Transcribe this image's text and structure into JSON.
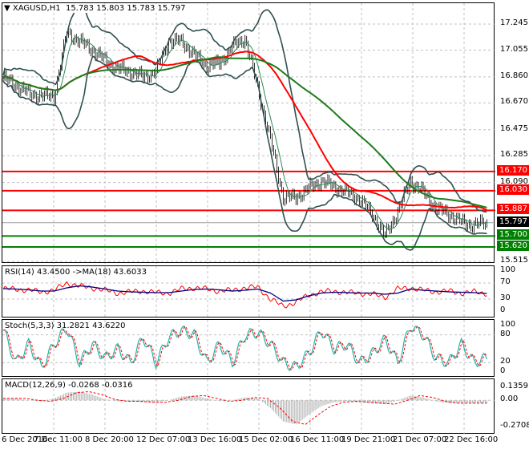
{
  "header": {
    "symbol": "XAGUSD,H1",
    "open": "15.783",
    "high": "15.803",
    "low": "15.783",
    "close": "15.797"
  },
  "indicators": {
    "rsi_label": "RSI(14) 43.4500  ->MA(18) 43.6033",
    "stoch_label": "Stoch(5,3,3) 31.2821 43.6220",
    "macd_label": "MACD(12,26,9) -0.0268 -0.0316"
  },
  "colors": {
    "red": "#ff0000",
    "green": "#008000",
    "ma_green": "#1e7a1e",
    "bands": "#2f4f4f",
    "current": "#000000",
    "rsi": "#ff0000",
    "rsi_ma": "#000080",
    "stoch_k": "#20b2aa",
    "stoch_d": "#ff0000",
    "hist": "#b0b0b0"
  },
  "chart_data": [
    {
      "type": "candlestick",
      "title": "XAGUSD,H1",
      "ylim": [
        15.515,
        17.245
      ],
      "yticks": [
        "17.245",
        "17.055",
        "16.860",
        "16.670",
        "16.475",
        "16.285",
        "16.090",
        "15.515"
      ],
      "xticks": [
        "6 Dec 2016",
        "7 Dec 11:00",
        "8 Dec 20:00",
        "12 Dec 07:00",
        "13 Dec 16:00",
        "15 Dec 02:00",
        "16 Dec 11:00",
        "19 Dec 21:00",
        "21 Dec 07:00",
        "22 Dec 16:00"
      ],
      "close_anchors_every_8_bars": [
        16.85,
        16.8,
        16.74,
        16.72,
        16.72,
        17.18,
        17.12,
        17.06,
        16.98,
        16.92,
        16.9,
        16.86,
        16.9,
        17.12,
        17.12,
        17.02,
        16.94,
        16.96,
        17.08,
        17.14,
        16.78,
        16.4,
        15.98,
        15.98,
        16.05,
        16.1,
        16.06,
        16.02,
        15.97,
        15.86,
        15.7,
        15.88,
        16.1,
        16.02,
        15.9,
        15.86,
        15.8,
        15.78,
        15.797
      ],
      "horizontal_levels": [
        {
          "value": "16.170",
          "color": "red"
        },
        {
          "value": "16.030",
          "color": "red"
        },
        {
          "value": "15.887",
          "color": "red"
        },
        {
          "value": "15.700",
          "color": "green"
        },
        {
          "value": "15.620",
          "color": "green"
        }
      ],
      "current_price": "15.797"
    },
    {
      "type": "line",
      "name": "RSI",
      "yticks": [
        "100",
        "70",
        "30",
        "0"
      ],
      "ylim": [
        0,
        100
      ],
      "rsi": [
        55,
        55,
        52,
        48,
        52,
        70,
        62,
        58,
        52,
        45,
        48,
        50,
        46,
        45,
        55,
        58,
        55,
        50,
        52,
        58,
        60,
        30,
        12,
        22,
        40,
        48,
        50,
        46,
        45,
        42,
        35,
        55,
        58,
        52,
        48,
        50,
        45,
        48,
        44
      ],
      "ma": [
        56,
        55,
        53,
        50,
        50,
        58,
        63,
        60,
        55,
        50,
        48,
        47,
        46,
        46,
        50,
        54,
        55,
        53,
        50,
        52,
        55,
        45,
        25,
        28,
        38,
        45,
        47,
        46,
        45,
        45,
        42,
        45,
        55,
        52,
        50,
        48,
        47,
        46,
        44
      ]
    },
    {
      "type": "line",
      "name": "Stochastic",
      "yticks": [
        "100",
        "80",
        "20",
        "0"
      ],
      "ylim": [
        0,
        100
      ],
      "k": [
        90,
        20,
        60,
        10,
        60,
        95,
        20,
        60,
        30,
        50,
        20,
        75,
        20,
        75,
        90,
        80,
        20,
        60,
        20,
        80,
        85,
        60,
        20,
        10,
        40,
        90,
        50,
        60,
        20,
        40,
        70,
        20,
        100,
        80,
        30,
        20,
        60,
        20,
        31
      ]
    },
    {
      "type": "bar",
      "name": "MACD",
      "yticks": [
        "0.1359",
        "0.00",
        "-0.2708"
      ],
      "ylim": [
        -0.2708,
        0.1359
      ],
      "hist": [
        0.02,
        0.02,
        0.0,
        -0.01,
        0.02,
        0.08,
        0.09,
        0.06,
        0.01,
        -0.01,
        -0.01,
        -0.02,
        -0.02,
        0.0,
        0.04,
        0.05,
        0.02,
        -0.01,
        0.0,
        0.03,
        0.02,
        -0.08,
        -0.22,
        -0.25,
        -0.15,
        -0.06,
        -0.02,
        -0.01,
        -0.02,
        -0.03,
        -0.04,
        0.0,
        0.05,
        0.03,
        -0.01,
        -0.03,
        -0.03,
        -0.03,
        -0.027
      ]
    }
  ]
}
